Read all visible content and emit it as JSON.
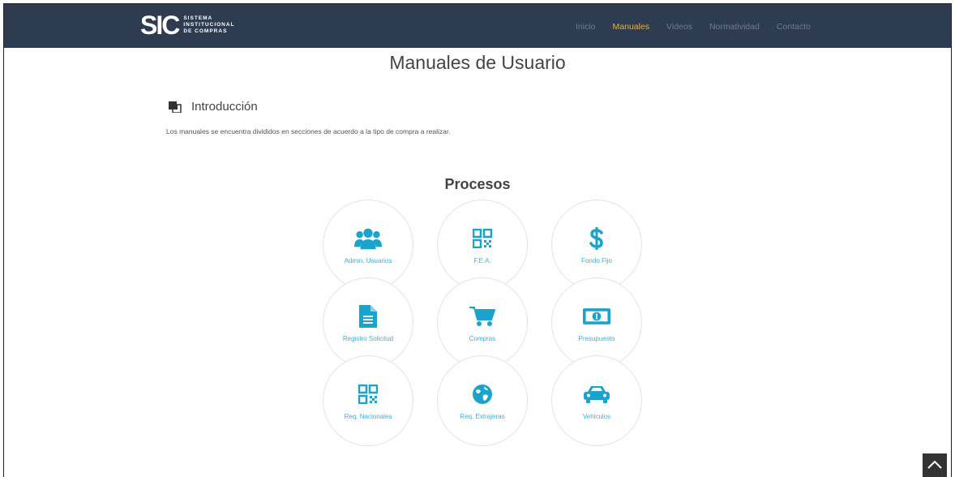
{
  "header": {
    "logo_mark": "SIC",
    "logo_lines": [
      "SISTEMA",
      "INSTITUCIONAL",
      "DE COMPRAS"
    ],
    "nav": [
      {
        "label": "Inicio",
        "active": false
      },
      {
        "label": "Manuales",
        "active": true
      },
      {
        "label": "Videos",
        "active": false
      },
      {
        "label": "Normatividad",
        "active": false
      },
      {
        "label": "Contacto",
        "active": false
      }
    ]
  },
  "main": {
    "title": "Manuales de Usuario",
    "intro_title": "Introducción",
    "intro_text": "Los manuales se encuentra divididos en secciones de acuerdo a la tipo de compra a realizar.",
    "section_title": "Procesos",
    "cards": [
      {
        "label": "Admin. Usuarios",
        "icon": "users-icon"
      },
      {
        "label": "F.E.A.",
        "icon": "qr-code-icon"
      },
      {
        "label": "Fondo Fijo",
        "icon": "dollar-icon"
      },
      {
        "label": "Registro Solicitud",
        "icon": "document-icon"
      },
      {
        "label": "Compras",
        "icon": "cart-icon"
      },
      {
        "label": "Presupuesto",
        "icon": "money-bill-icon"
      },
      {
        "label": "Req. Nacionales",
        "icon": "qr-code-icon"
      },
      {
        "label": "Req. Extrajeras",
        "icon": "globe-icon"
      },
      {
        "label": "Vehiculos",
        "icon": "car-icon"
      }
    ]
  },
  "colors": {
    "navbar": "#2e3c51",
    "nav_active": "#e5b432",
    "accent": "#1aa3cc"
  }
}
